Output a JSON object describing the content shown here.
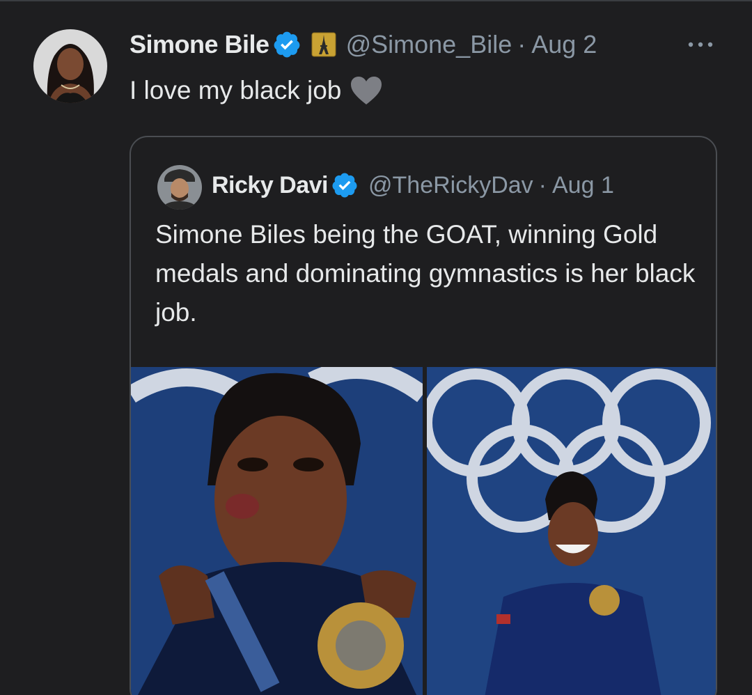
{
  "tweet": {
    "display_name": "Simone Bile",
    "handle": "@Simone_Bile",
    "separator": "·",
    "date": "Aug 2",
    "text": "I love my black job",
    "icons": {
      "avatar": "avatar",
      "verified": "verified-badge-icon",
      "flag": "eiffel-tower-badge-icon",
      "more": "more-options-icon",
      "heart": "black-heart-icon"
    }
  },
  "quoted_tweet": {
    "display_name": "Ricky Davi",
    "handle": "@TheRickyDav",
    "separator": "·",
    "date": "Aug 1",
    "text": "Simone Biles being the GOAT, winning Gold medals and dominating gymnastics is her black job.",
    "media": [
      {
        "name": "gymnast-kissing-pose-photo"
      },
      {
        "name": "gymnast-olympic-rings-photo"
      }
    ]
  },
  "colors": {
    "background": "#1e1e20",
    "text": "#e7e9ea",
    "muted": "#8b98a5",
    "verified": "#1d9bf0",
    "border": "#4a4d52"
  }
}
